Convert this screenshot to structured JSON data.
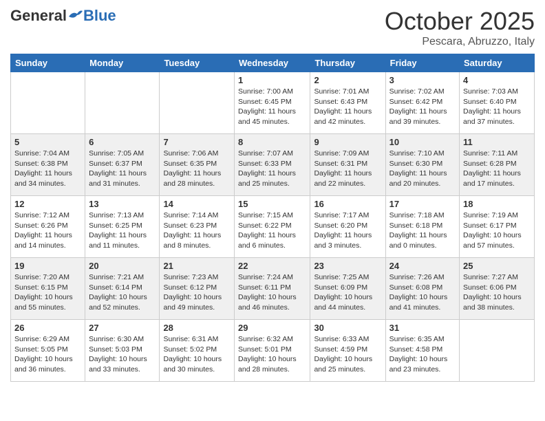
{
  "header": {
    "logo_general": "General",
    "logo_blue": "Blue",
    "month": "October 2025",
    "location": "Pescara, Abruzzo, Italy"
  },
  "days_of_week": [
    "Sunday",
    "Monday",
    "Tuesday",
    "Wednesday",
    "Thursday",
    "Friday",
    "Saturday"
  ],
  "weeks": [
    {
      "shaded": false,
      "days": [
        {
          "date": "",
          "info": ""
        },
        {
          "date": "",
          "info": ""
        },
        {
          "date": "",
          "info": ""
        },
        {
          "date": "1",
          "info": "Sunrise: 7:00 AM\nSunset: 6:45 PM\nDaylight: 11 hours\nand 45 minutes."
        },
        {
          "date": "2",
          "info": "Sunrise: 7:01 AM\nSunset: 6:43 PM\nDaylight: 11 hours\nand 42 minutes."
        },
        {
          "date": "3",
          "info": "Sunrise: 7:02 AM\nSunset: 6:42 PM\nDaylight: 11 hours\nand 39 minutes."
        },
        {
          "date": "4",
          "info": "Sunrise: 7:03 AM\nSunset: 6:40 PM\nDaylight: 11 hours\nand 37 minutes."
        }
      ]
    },
    {
      "shaded": true,
      "days": [
        {
          "date": "5",
          "info": "Sunrise: 7:04 AM\nSunset: 6:38 PM\nDaylight: 11 hours\nand 34 minutes."
        },
        {
          "date": "6",
          "info": "Sunrise: 7:05 AM\nSunset: 6:37 PM\nDaylight: 11 hours\nand 31 minutes."
        },
        {
          "date": "7",
          "info": "Sunrise: 7:06 AM\nSunset: 6:35 PM\nDaylight: 11 hours\nand 28 minutes."
        },
        {
          "date": "8",
          "info": "Sunrise: 7:07 AM\nSunset: 6:33 PM\nDaylight: 11 hours\nand 25 minutes."
        },
        {
          "date": "9",
          "info": "Sunrise: 7:09 AM\nSunset: 6:31 PM\nDaylight: 11 hours\nand 22 minutes."
        },
        {
          "date": "10",
          "info": "Sunrise: 7:10 AM\nSunset: 6:30 PM\nDaylight: 11 hours\nand 20 minutes."
        },
        {
          "date": "11",
          "info": "Sunrise: 7:11 AM\nSunset: 6:28 PM\nDaylight: 11 hours\nand 17 minutes."
        }
      ]
    },
    {
      "shaded": false,
      "days": [
        {
          "date": "12",
          "info": "Sunrise: 7:12 AM\nSunset: 6:26 PM\nDaylight: 11 hours\nand 14 minutes."
        },
        {
          "date": "13",
          "info": "Sunrise: 7:13 AM\nSunset: 6:25 PM\nDaylight: 11 hours\nand 11 minutes."
        },
        {
          "date": "14",
          "info": "Sunrise: 7:14 AM\nSunset: 6:23 PM\nDaylight: 11 hours\nand 8 minutes."
        },
        {
          "date": "15",
          "info": "Sunrise: 7:15 AM\nSunset: 6:22 PM\nDaylight: 11 hours\nand 6 minutes."
        },
        {
          "date": "16",
          "info": "Sunrise: 7:17 AM\nSunset: 6:20 PM\nDaylight: 11 hours\nand 3 minutes."
        },
        {
          "date": "17",
          "info": "Sunrise: 7:18 AM\nSunset: 6:18 PM\nDaylight: 11 hours\nand 0 minutes."
        },
        {
          "date": "18",
          "info": "Sunrise: 7:19 AM\nSunset: 6:17 PM\nDaylight: 10 hours\nand 57 minutes."
        }
      ]
    },
    {
      "shaded": true,
      "days": [
        {
          "date": "19",
          "info": "Sunrise: 7:20 AM\nSunset: 6:15 PM\nDaylight: 10 hours\nand 55 minutes."
        },
        {
          "date": "20",
          "info": "Sunrise: 7:21 AM\nSunset: 6:14 PM\nDaylight: 10 hours\nand 52 minutes."
        },
        {
          "date": "21",
          "info": "Sunrise: 7:23 AM\nSunset: 6:12 PM\nDaylight: 10 hours\nand 49 minutes."
        },
        {
          "date": "22",
          "info": "Sunrise: 7:24 AM\nSunset: 6:11 PM\nDaylight: 10 hours\nand 46 minutes."
        },
        {
          "date": "23",
          "info": "Sunrise: 7:25 AM\nSunset: 6:09 PM\nDaylight: 10 hours\nand 44 minutes."
        },
        {
          "date": "24",
          "info": "Sunrise: 7:26 AM\nSunset: 6:08 PM\nDaylight: 10 hours\nand 41 minutes."
        },
        {
          "date": "25",
          "info": "Sunrise: 7:27 AM\nSunset: 6:06 PM\nDaylight: 10 hours\nand 38 minutes."
        }
      ]
    },
    {
      "shaded": false,
      "days": [
        {
          "date": "26",
          "info": "Sunrise: 6:29 AM\nSunset: 5:05 PM\nDaylight: 10 hours\nand 36 minutes."
        },
        {
          "date": "27",
          "info": "Sunrise: 6:30 AM\nSunset: 5:03 PM\nDaylight: 10 hours\nand 33 minutes."
        },
        {
          "date": "28",
          "info": "Sunrise: 6:31 AM\nSunset: 5:02 PM\nDaylight: 10 hours\nand 30 minutes."
        },
        {
          "date": "29",
          "info": "Sunrise: 6:32 AM\nSunset: 5:01 PM\nDaylight: 10 hours\nand 28 minutes."
        },
        {
          "date": "30",
          "info": "Sunrise: 6:33 AM\nSunset: 4:59 PM\nDaylight: 10 hours\nand 25 minutes."
        },
        {
          "date": "31",
          "info": "Sunrise: 6:35 AM\nSunset: 4:58 PM\nDaylight: 10 hours\nand 23 minutes."
        },
        {
          "date": "",
          "info": ""
        }
      ]
    }
  ]
}
